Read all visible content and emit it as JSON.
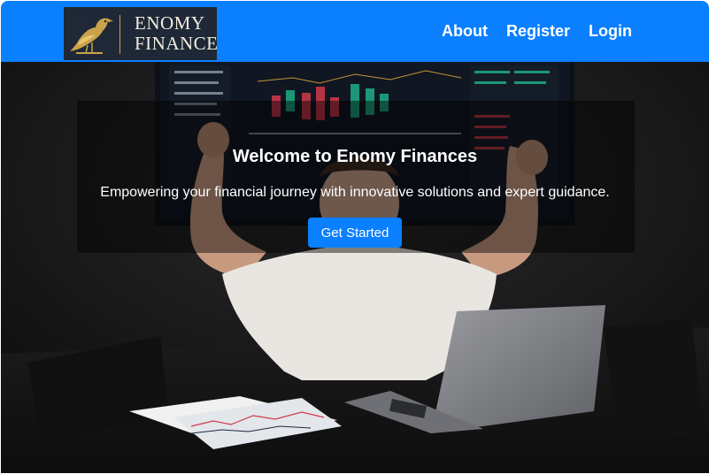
{
  "header": {
    "logo": {
      "line1": "ENOMY",
      "line2": "FINANCE"
    },
    "nav": [
      {
        "label": "About"
      },
      {
        "label": "Register"
      },
      {
        "label": "Login"
      }
    ]
  },
  "hero": {
    "title": "Welcome to Enomy Finances",
    "subtitle": "Empowering your financial journey with innovative solutions and expert guidance.",
    "cta_label": "Get Started"
  },
  "colors": {
    "nav_background": "#0a7fff",
    "button_background": "#0a7fff",
    "logo_background": "#1e2836",
    "logo_gold": "#c9a24a"
  },
  "icons": {
    "logo_mark": "bird-icon"
  }
}
